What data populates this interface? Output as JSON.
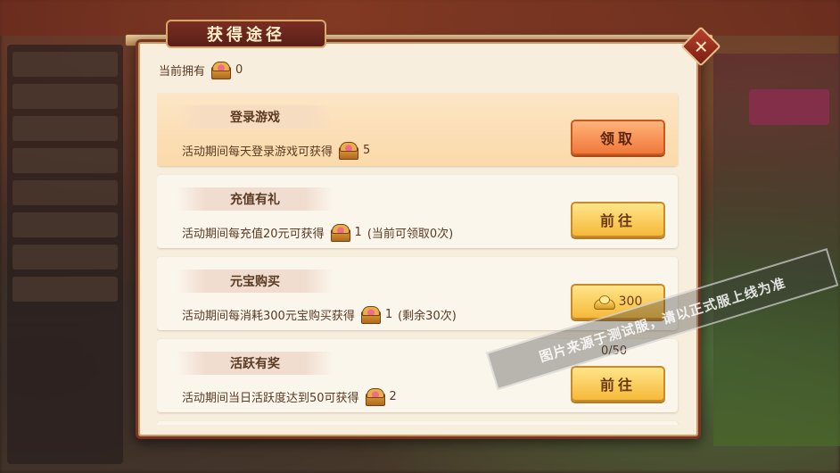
{
  "dialog": {
    "title": "获得途径",
    "close_icon": "close-x-icon"
  },
  "owned": {
    "label": "当前拥有",
    "icon": "treasure-chest-icon",
    "count": "0"
  },
  "tasks": [
    {
      "title": "登录游戏",
      "desc": "活动期间每天登录游戏可获得",
      "reward_count": "5",
      "reward_extra": "",
      "button_label": "领取",
      "button_style": "orange",
      "active": true
    },
    {
      "title": "充值有礼",
      "desc": "活动期间每充值20元可获得",
      "reward_count": "1",
      "reward_extra": "(当前可领取0次)",
      "button_label": "前往",
      "button_style": "gold",
      "active": false
    },
    {
      "title": "元宝购买",
      "desc": "活动期间每消耗300元宝购买获得",
      "reward_count": "1",
      "reward_extra": "(剩余30次)",
      "button_label": "300",
      "button_icon": "gold-ingot-icon",
      "button_style": "gold",
      "active": false
    },
    {
      "title": "活跃有奖",
      "desc": "活动期间当日活跃度达到50可获得",
      "reward_count": "2",
      "reward_extra": "",
      "button_label": "前往",
      "button_style": "gold",
      "progress": "0/50",
      "active": false
    }
  ],
  "watermark": "图片来源于测试服，请以正式服上线为准",
  "colors": {
    "frame": "#7a3522",
    "panel": "#f7eedd",
    "gold_button": "#f6b93a",
    "orange_button": "#f0783a",
    "text": "#5b3a22"
  }
}
